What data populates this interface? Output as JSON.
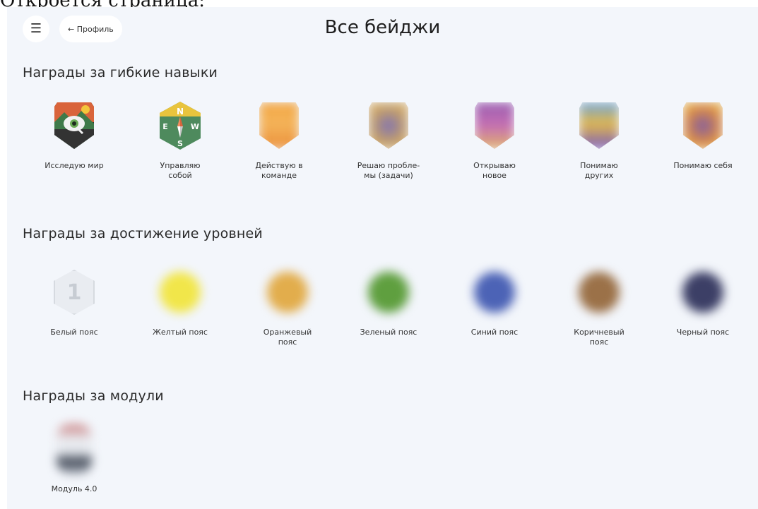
{
  "caption": "Откроется страница:",
  "header": {
    "menu_icon": "menu-icon",
    "back_label": "← Профиль",
    "title": "Все бейджи"
  },
  "sections": {
    "soft_skills": {
      "title": "Награды за гибкие навыки",
      "items": [
        {
          "label": "Исследую мир",
          "icon": "explore-eye-icon"
        },
        {
          "label": "Управляю собой",
          "icon": "compass-icon"
        },
        {
          "label": "Действую в команде",
          "icon": "team-badge-icon"
        },
        {
          "label": "Решаю пробле-мы (задачи)",
          "icon": "problem-badge-icon"
        },
        {
          "label": "Открываю новое",
          "icon": "discover-badge-icon"
        },
        {
          "label": "Понимаю других",
          "icon": "understand-others-badge-icon"
        },
        {
          "label": "Понимаю себя",
          "icon": "understand-self-badge-icon"
        }
      ]
    },
    "levels": {
      "title": "Награды за достижение уровней",
      "items": [
        {
          "label": "Белый пояс",
          "color": "#e9ecf1",
          "number": "1"
        },
        {
          "label": "Желтый пояс",
          "color": "#f1e64a"
        },
        {
          "label": "Оранжевый пояс",
          "color": "#e2ad4c"
        },
        {
          "label": "Зеленый пояс",
          "color": "#5f9f3f"
        },
        {
          "label": "Синий пояс",
          "color": "#4c63b6"
        },
        {
          "label": "Коричневый пояс",
          "color": "#9b7148"
        },
        {
          "label": "Черный пояс",
          "color": "#3c3f66"
        }
      ]
    },
    "modules": {
      "title": "Награды за модули",
      "items": [
        {
          "label": "Модуль 4.0",
          "icon": "module-badge-icon"
        }
      ]
    }
  }
}
